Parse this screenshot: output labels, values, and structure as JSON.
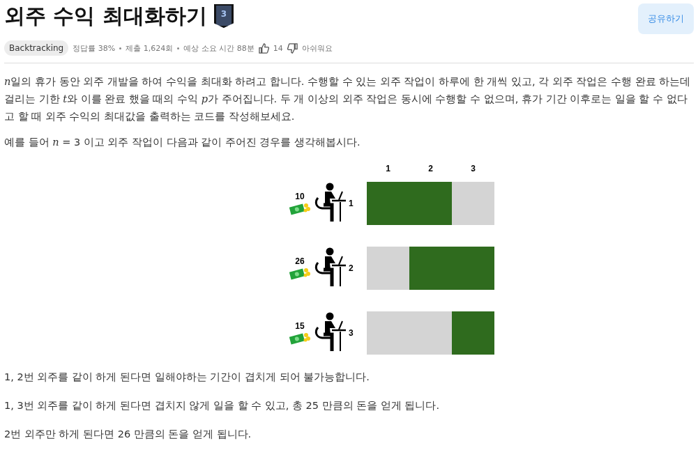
{
  "title": "외주 수익 최대화하기",
  "level_badge": "3",
  "share_button": "공유하기",
  "meta": {
    "tag": "Backtracking",
    "items": [
      "정답률 38%",
      "제출 1,624회",
      "예상 소요 시간 88분"
    ],
    "likes": "14",
    "dislike_label": "아쉬워요"
  },
  "paragraphs": [
    [
      {
        "kind": "var",
        "text": "n"
      },
      {
        "kind": "text",
        "text": "일의 휴가 동안 외주 개발을 하여 수익을 최대화 하려고 합니다. 수행할 수 있는 외주 작업이 하루에 한 개씩 있고, 각 외주 작업은 수행 완료 하는데 걸리는 기한 "
      },
      {
        "kind": "var",
        "text": "t"
      },
      {
        "kind": "text",
        "text": "와 이를 완료 했을 때의 수익 "
      },
      {
        "kind": "var",
        "text": "p"
      },
      {
        "kind": "text",
        "text": "가 주어집니다. 두 개 이상의 외주 작업은 동시에 수행할 수 없으며, 휴가 기간 이후로는 일을 할 수 없다고 할 때 외주 수익의 최대값을 출력하는 코드를 작성해보세요."
      }
    ],
    [
      {
        "kind": "text",
        "text": "예를 들어 "
      },
      {
        "kind": "var",
        "text": "n"
      },
      {
        "kind": "text",
        "text": " = 3 이고 외주 작업이 다음과 같이 주어진 경우를 생각해봅시다."
      }
    ]
  ],
  "figure": {
    "days": [
      "1",
      "2",
      "3"
    ],
    "jobs": [
      {
        "pay": "10",
        "label": "1",
        "busy": [
          true,
          true,
          false
        ]
      },
      {
        "pay": "26",
        "label": "2",
        "busy": [
          false,
          true,
          true
        ]
      },
      {
        "pay": "15",
        "label": "3",
        "busy": [
          false,
          false,
          true
        ]
      }
    ]
  },
  "notes": [
    "1, 2번 외주를 같이 하게 된다면 일해야하는 기간이 겹치게 되어 불가능합니다.",
    "1, 3번 외주를 같이 하게 된다면 겹치지 않게 일을 할 수 있고, 총 25 만큼의 돈을 얻게 됩니다.",
    "2번 외주만 하게 된다면 26 만큼의 돈을 얻게 됩니다."
  ]
}
